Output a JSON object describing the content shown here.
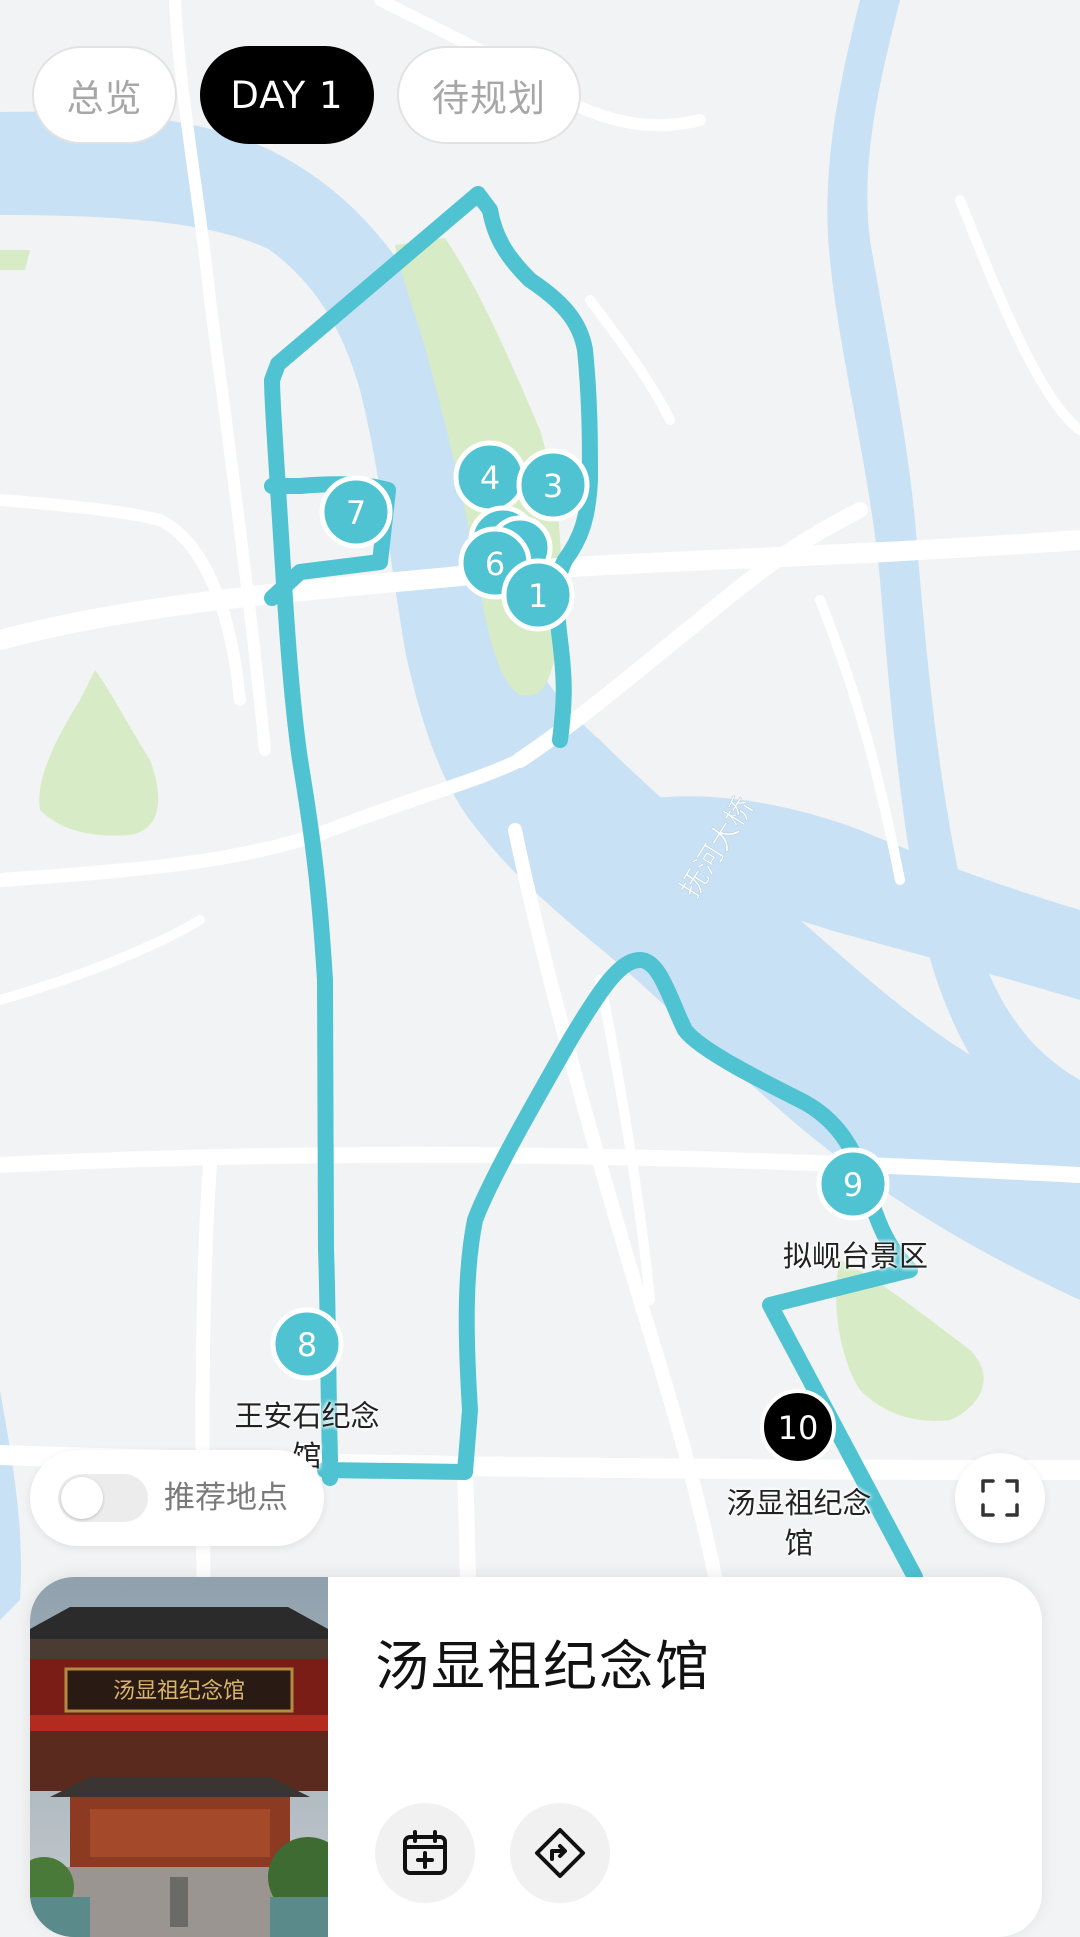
{
  "tabs": [
    {
      "label": "总览",
      "active": false
    },
    {
      "label": "DAY 1",
      "active": true
    },
    {
      "label": "待规划",
      "active": false
    }
  ],
  "map": {
    "road_label": "抚河大桥",
    "route_color": "#4fc3d2",
    "markers": [
      {
        "number": "1"
      },
      {
        "number": "3"
      },
      {
        "number": "4"
      },
      {
        "number": "6"
      },
      {
        "number": "7"
      },
      {
        "number": "8"
      },
      {
        "number": "9"
      },
      {
        "number": "10",
        "selected": true
      }
    ],
    "poi_labels": {
      "marker_8_line1": "王安石纪念",
      "marker_8_line2": "馆",
      "marker_9": "拟岘台景区",
      "marker_10_line1": "汤显祖纪念",
      "marker_10_line2": "馆"
    }
  },
  "controls": {
    "recommend_toggle_label": "推荐地点",
    "recommend_toggle_on": false,
    "fullscreen_icon": "fullscreen-icon"
  },
  "card": {
    "title": "汤显祖纪念馆",
    "photo_sign_text": "汤显祖纪念馆",
    "buttons": [
      {
        "icon": "calendar-add-icon"
      },
      {
        "icon": "navigate-icon"
      }
    ]
  }
}
